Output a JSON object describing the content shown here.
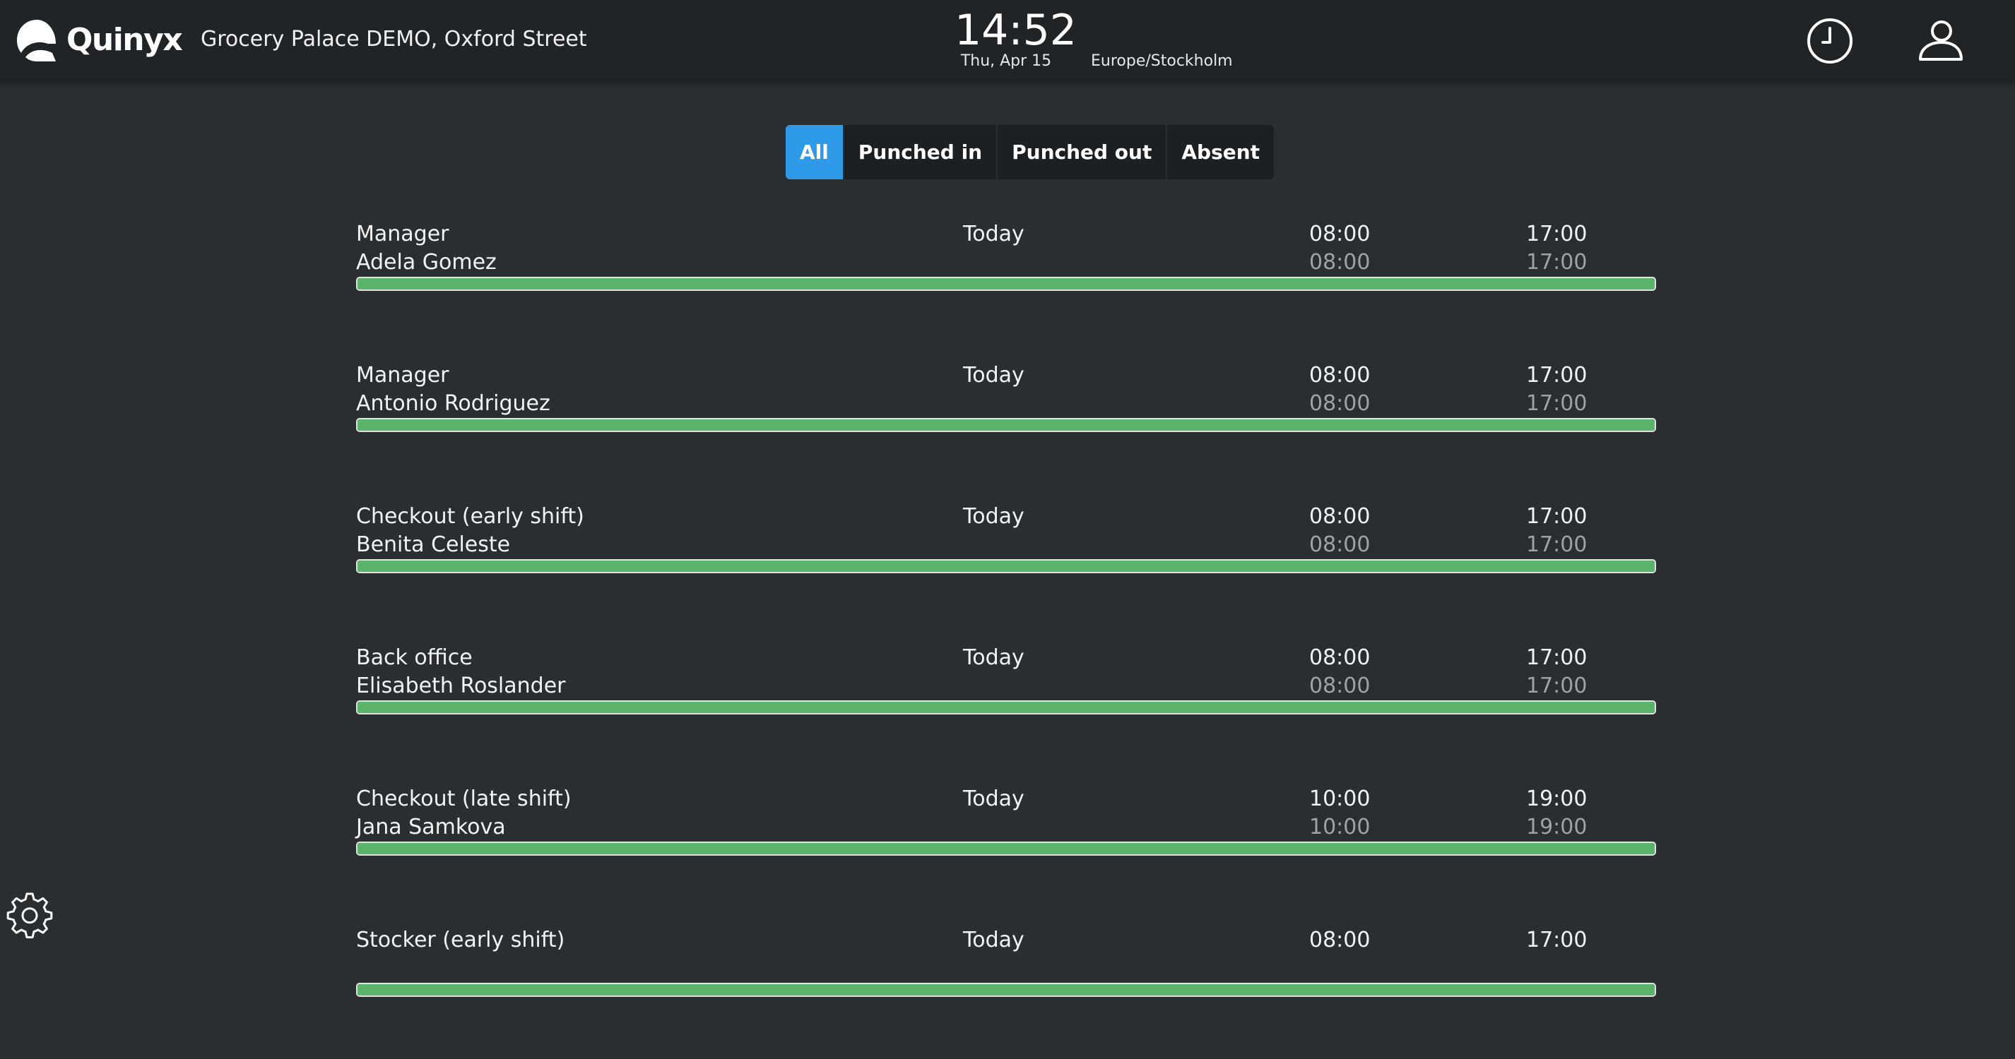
{
  "header": {
    "logo_text": "Quinyx",
    "store_name": "Grocery Palace DEMO, Oxford Street",
    "time": "14:52",
    "date": "Thu, Apr 15",
    "timezone": "Europe/Stockholm",
    "icons": [
      "logo-icon",
      "history-clock-icon",
      "user-profile-icon"
    ]
  },
  "filters": [
    {
      "label": "All",
      "active": true
    },
    {
      "label": "Punched in",
      "active": false
    },
    {
      "label": "Punched out",
      "active": false
    },
    {
      "label": "Absent",
      "active": false
    }
  ],
  "shifts": [
    {
      "role": "Manager",
      "employee": "Adela Gomez",
      "day": "Today",
      "scheduled_start": "08:00",
      "scheduled_end": "17:00",
      "actual_start": "08:00",
      "actual_end": "17:00",
      "progress": 1.0
    },
    {
      "role": "Manager",
      "employee": "Antonio Rodriguez",
      "day": "Today",
      "scheduled_start": "08:00",
      "scheduled_end": "17:00",
      "actual_start": "08:00",
      "actual_end": "17:00",
      "progress": 1.0
    },
    {
      "role": "Checkout (early shift)",
      "employee": "Benita Celeste",
      "day": "Today",
      "scheduled_start": "08:00",
      "scheduled_end": "17:00",
      "actual_start": "08:00",
      "actual_end": "17:00",
      "progress": 1.0
    },
    {
      "role": "Back office",
      "employee": "Elisabeth Roslander",
      "day": "Today",
      "scheduled_start": "08:00",
      "scheduled_end": "17:00",
      "actual_start": "08:00",
      "actual_end": "17:00",
      "progress": 1.0
    },
    {
      "role": "Checkout (late shift)",
      "employee": "Jana Samkova",
      "day": "Today",
      "scheduled_start": "10:00",
      "scheduled_end": "19:00",
      "actual_start": "10:00",
      "actual_end": "19:00",
      "progress": 1.0
    },
    {
      "role": "Stocker (early shift)",
      "employee": "",
      "day": "Today",
      "scheduled_start": "08:00",
      "scheduled_end": "17:00",
      "actual_start": "",
      "actual_end": "",
      "progress": 1.0
    }
  ],
  "footer": {
    "icons": [
      "settings-gear-icon"
    ]
  },
  "colors": {
    "background": "#2a2e31",
    "topbar": "#212427",
    "accent_blue": "#2f9ae8",
    "progress_green": "#5cb36a",
    "muted_text": "#9ea3a8"
  }
}
